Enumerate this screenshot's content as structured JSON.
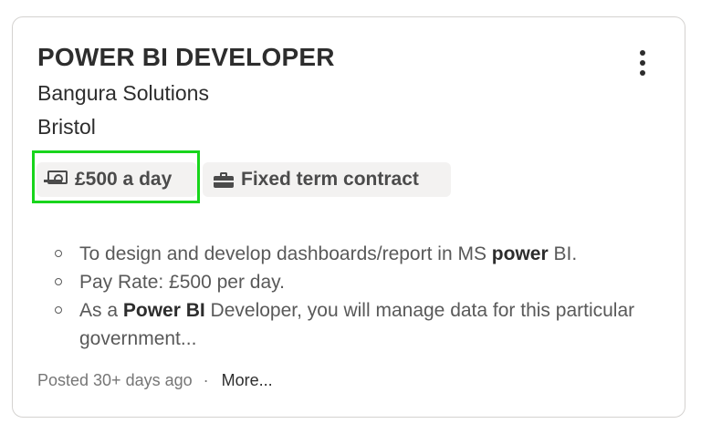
{
  "job": {
    "title": "POWER BI DEVELOPER",
    "company": "Bangura Solutions",
    "location": "Bristol",
    "salary": "£500 a day",
    "job_type": "Fixed term contract",
    "bullets": [
      [
        {
          "t": "To design and develop dashboards/report in MS "
        },
        {
          "t": "power",
          "b": true
        },
        {
          "t": " BI."
        }
      ],
      [
        {
          "t": "Pay Rate: £500 per day."
        }
      ],
      [
        {
          "t": "As a "
        },
        {
          "t": "Power BI",
          "b": true
        },
        {
          "t": " Developer, you will manage data for this particular government..."
        }
      ]
    ],
    "posted": "Posted 30+ days ago",
    "separator": "·",
    "more_label": "More..."
  },
  "icons": {
    "menu": "kebab-menu-icon",
    "salary": "money-icon",
    "job_type": "briefcase-icon"
  },
  "colors": {
    "highlight": "#18d51c",
    "chip_bg": "#f3f2f1",
    "text": "#2d2d2d"
  }
}
